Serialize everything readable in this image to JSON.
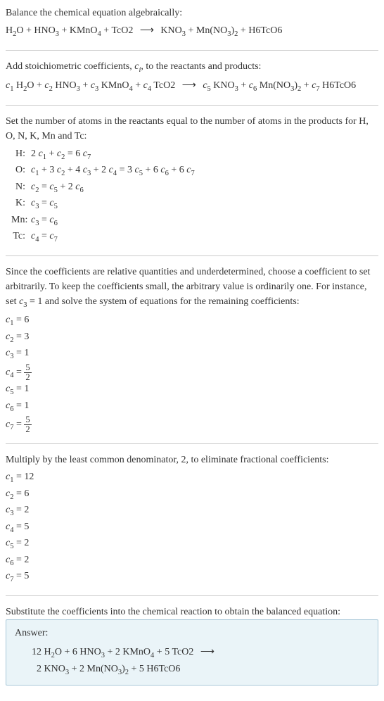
{
  "section1": {
    "title": "Balance the chemical equation algebraically:",
    "equation": "H₂O + HNO₃ + KMnO₄ + TcO2 ⟶ KNO₃ + Mn(NO₃)₂ + H6TcO6"
  },
  "section2": {
    "title_part1": "Add stoichiometric coefficients, ",
    "title_ci": "cᵢ",
    "title_part2": ", to the reactants and products:",
    "equation": "c₁ H₂O + c₂ HNO₃ + c₃ KMnO₄ + c₄ TcO2 ⟶ c₅ KNO₃ + c₆ Mn(NO₃)₂ + c₇ H6TcO6"
  },
  "section3": {
    "title": "Set the number of atoms in the reactants equal to the number of atoms in the products for H, O, N, K, Mn and Tc:",
    "atoms": [
      {
        "label": "H:",
        "eq": "2 c₁ + c₂ = 6 c₇"
      },
      {
        "label": "O:",
        "eq": "c₁ + 3 c₂ + 4 c₃ + 2 c₄ = 3 c₅ + 6 c₆ + 6 c₇"
      },
      {
        "label": "N:",
        "eq": "c₂ = c₅ + 2 c₆"
      },
      {
        "label": "K:",
        "eq": "c₃ = c₅"
      },
      {
        "label": "Mn:",
        "eq": "c₃ = c₆"
      },
      {
        "label": "Tc:",
        "eq": "c₄ = c₇"
      }
    ]
  },
  "section4": {
    "title": "Since the coefficients are relative quantities and underdetermined, choose a coefficient to set arbitrarily. To keep the coefficients small, the arbitrary value is ordinarily one. For instance, set c₃ = 1 and solve the system of equations for the remaining coefficients:",
    "coeffs": [
      {
        "text": "c₁ = 6",
        "frac": false
      },
      {
        "text": "c₂ = 3",
        "frac": false
      },
      {
        "text": "c₃ = 1",
        "frac": false
      },
      {
        "text": "c₄ = ",
        "frac": true,
        "num": "5",
        "den": "2"
      },
      {
        "text": "c₅ = 1",
        "frac": false
      },
      {
        "text": "c₆ = 1",
        "frac": false
      },
      {
        "text": "c₇ = ",
        "frac": true,
        "num": "5",
        "den": "2"
      }
    ]
  },
  "section5": {
    "title": "Multiply by the least common denominator, 2, to eliminate fractional coefficients:",
    "coeffs": [
      "c₁ = 12",
      "c₂ = 6",
      "c₃ = 2",
      "c₄ = 5",
      "c₅ = 2",
      "c₆ = 2",
      "c₇ = 5"
    ]
  },
  "section6": {
    "title": "Substitute the coefficients into the chemical reaction to obtain the balanced equation:",
    "answer_label": "Answer:",
    "answer_line1": "12 H₂O + 6 HNO₃ + 2 KMnO₄ + 5 TcO2 ⟶",
    "answer_line2": "2 KNO₃ + 2 Mn(NO₃)₂ + 5 H6TcO6"
  }
}
